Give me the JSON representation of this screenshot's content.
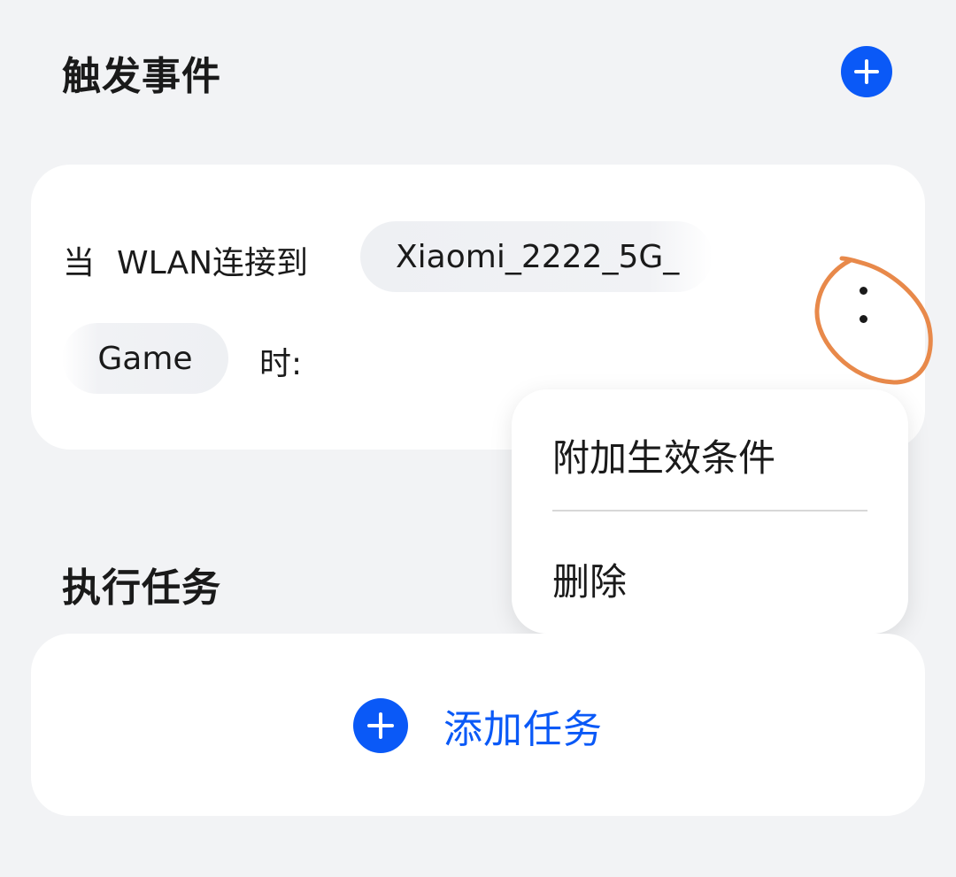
{
  "trigger_section": {
    "title": "触发事件",
    "condition": {
      "when": "当",
      "wlan_text": "WLAN连接到",
      "ssid_part1": "Xiaomi_2222_5G_",
      "ssid_part2": "Game",
      "time_suffix": "时:"
    }
  },
  "menu": {
    "add_condition": "附加生效条件",
    "delete": "删除"
  },
  "task_section": {
    "title": "执行任务",
    "add_task_label": "添加任务"
  },
  "colors": {
    "accent": "#0a59f7",
    "annotation": "#e8894a",
    "background": "#f2f3f5"
  },
  "icons": {
    "add": "plus-icon",
    "more": "more-vertical-icon"
  }
}
